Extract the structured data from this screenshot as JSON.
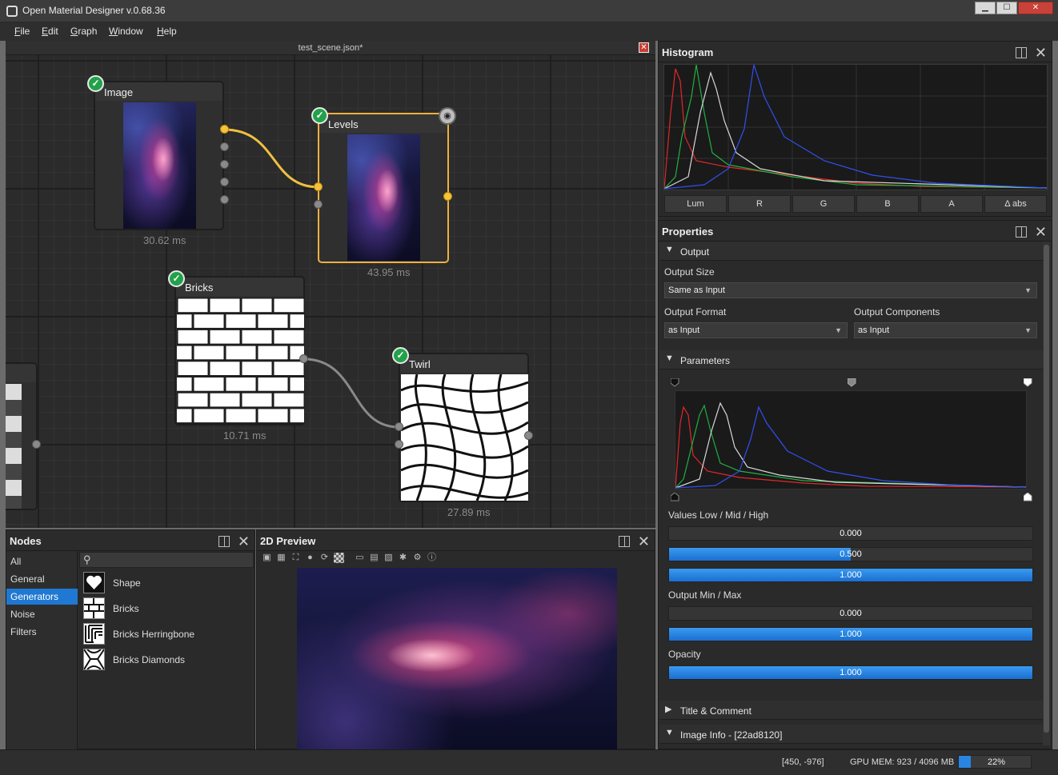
{
  "window": {
    "title": "Open Material Designer v.0.68.36",
    "min_glyph": "▁",
    "max_glyph": "☐",
    "close_glyph": "✕"
  },
  "menu": [
    {
      "first": "F",
      "rest": "ile"
    },
    {
      "first": "E",
      "rest": "dit"
    },
    {
      "first": "G",
      "rest": "raph"
    },
    {
      "first": "W",
      "rest": "indow"
    },
    {
      "first": "H",
      "rest": "elp"
    }
  ],
  "graph": {
    "document_tab": "test_scene.json*",
    "nodes": [
      {
        "title": "Image",
        "time": "30.62 ms"
      },
      {
        "title": "Levels",
        "time": "43.95 ms"
      },
      {
        "title": "Bricks",
        "time": "10.71 ms"
      },
      {
        "title": "Twirl",
        "time": "27.89 ms"
      }
    ]
  },
  "nodes_panel": {
    "title": "Nodes",
    "categories": [
      "All",
      "General",
      "Generators",
      "Noise",
      "Filters"
    ],
    "selected_category": "Generators",
    "items": [
      {
        "label": "Shape",
        "icon": "shape-heart-icon"
      },
      {
        "label": "Bricks",
        "icon": "bricks-icon"
      },
      {
        "label": "Bricks Herringbone",
        "icon": "bricks-herringbone-icon"
      },
      {
        "label": "Bricks Diamonds",
        "icon": "bricks-diamonds-icon"
      }
    ]
  },
  "preview_panel": {
    "title": "2D Preview"
  },
  "histogram": {
    "title": "Histogram",
    "tabs": [
      "Lum",
      "R",
      "G",
      "B",
      "A",
      "Δ abs"
    ],
    "colors": {
      "lum": "#d8d8d8",
      "r": "#e02828",
      "g": "#20b040",
      "b": "#3050f0"
    }
  },
  "properties": {
    "title": "Properties",
    "output_section": "Output",
    "output_size_label": "Output Size",
    "output_size_value": "Same as Input",
    "output_format_label": "Output Format",
    "output_format_value": "as Input",
    "output_components_label": "Output Components",
    "output_components_value": "as Input",
    "parameters_section": "Parameters",
    "values_label": "Values Low / Mid / High",
    "values": [
      {
        "text": "0.000",
        "fraction": 0.0
      },
      {
        "text": "0.500",
        "fraction": 0.5
      },
      {
        "text": "1.000",
        "fraction": 1.0
      }
    ],
    "output_minmax_label": "Output Min / Max",
    "output_minmax": [
      {
        "text": "0.000",
        "fraction": 0.0
      },
      {
        "text": "1.000",
        "fraction": 1.0
      }
    ],
    "opacity_label": "Opacity",
    "opacity": {
      "text": "1.000",
      "fraction": 1.0
    },
    "title_comment_section": "Title & Comment",
    "image_info_section": "Image Info - [22ad8120]"
  },
  "status": {
    "coords": "[450, -976]",
    "gpu_mem": "GPU MEM: 923 / 4096 MB",
    "percent_text": "22%",
    "percent_value": 0.22
  },
  "accent_color": "#1f78d2"
}
